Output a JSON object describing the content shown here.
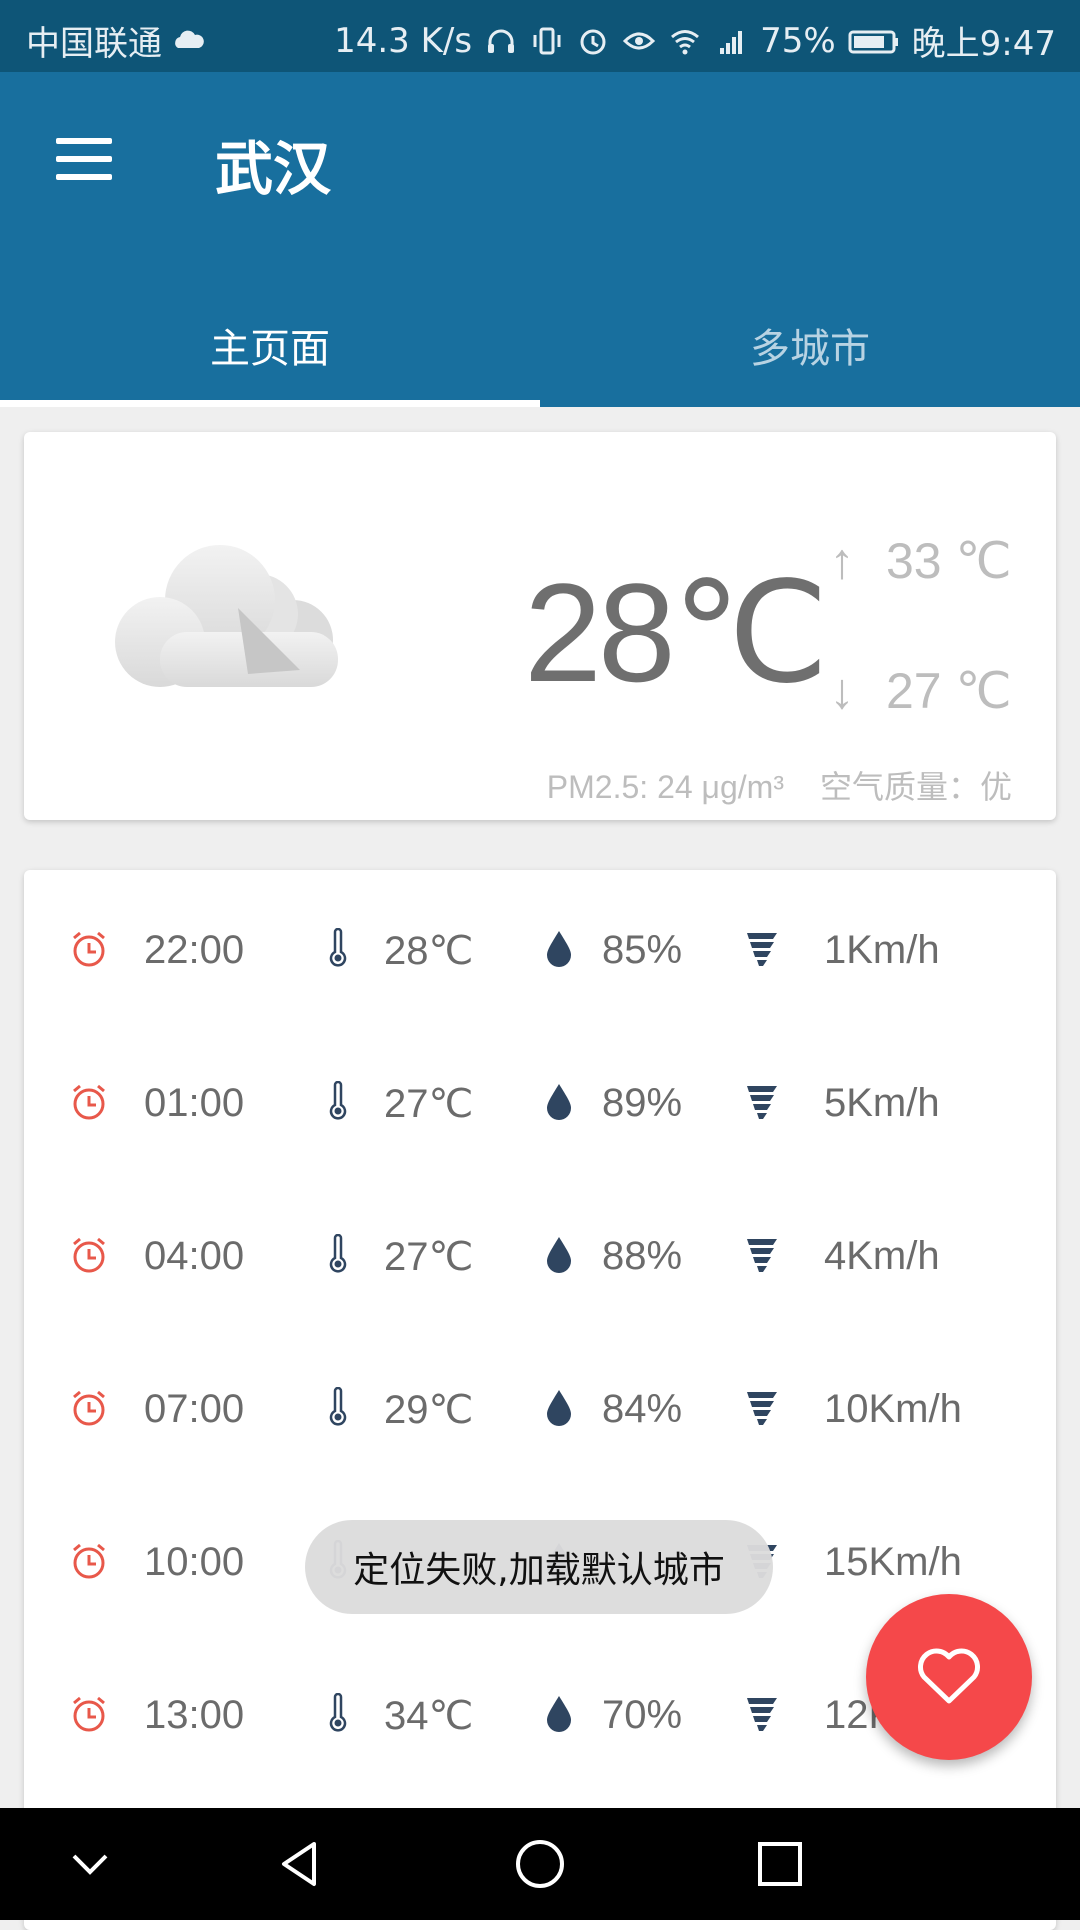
{
  "status_bar": {
    "carrier": "中国联通",
    "speed": "14.3 K/s",
    "battery": "75%",
    "time": "晚上9:47"
  },
  "app_bar": {
    "title": "武汉",
    "tabs": [
      {
        "label": "主页面",
        "active": true
      },
      {
        "label": "多城市",
        "active": false
      }
    ]
  },
  "current": {
    "temperature": "28℃",
    "high": "33 ℃",
    "low": "27 ℃",
    "pm25": "PM2.5: 24 μg/m³",
    "air_quality": "空气质量：优",
    "condition_icon": "cloudy-icon"
  },
  "hourly": [
    {
      "time": "22:00",
      "temp": "28℃",
      "humidity": "85%",
      "wind": "1Km/h"
    },
    {
      "time": "01:00",
      "temp": "27℃",
      "humidity": "89%",
      "wind": "5Km/h"
    },
    {
      "time": "04:00",
      "temp": "27℃",
      "humidity": "88%",
      "wind": "4Km/h"
    },
    {
      "time": "07:00",
      "temp": "29℃",
      "humidity": "84%",
      "wind": "10Km/h"
    },
    {
      "time": "10:00",
      "temp": "",
      "humidity": "",
      "wind": "15Km/h"
    },
    {
      "time": "13:00",
      "temp": "34℃",
      "humidity": "70%",
      "wind": "12K"
    }
  ],
  "toast": "定位失败,加载默认城市",
  "colors": {
    "status_bar": "#0e5577",
    "app_bar": "#186f9e",
    "fab": "#f5484a",
    "clock_icon": "#e8584a",
    "data_icon": "#2f4560"
  }
}
